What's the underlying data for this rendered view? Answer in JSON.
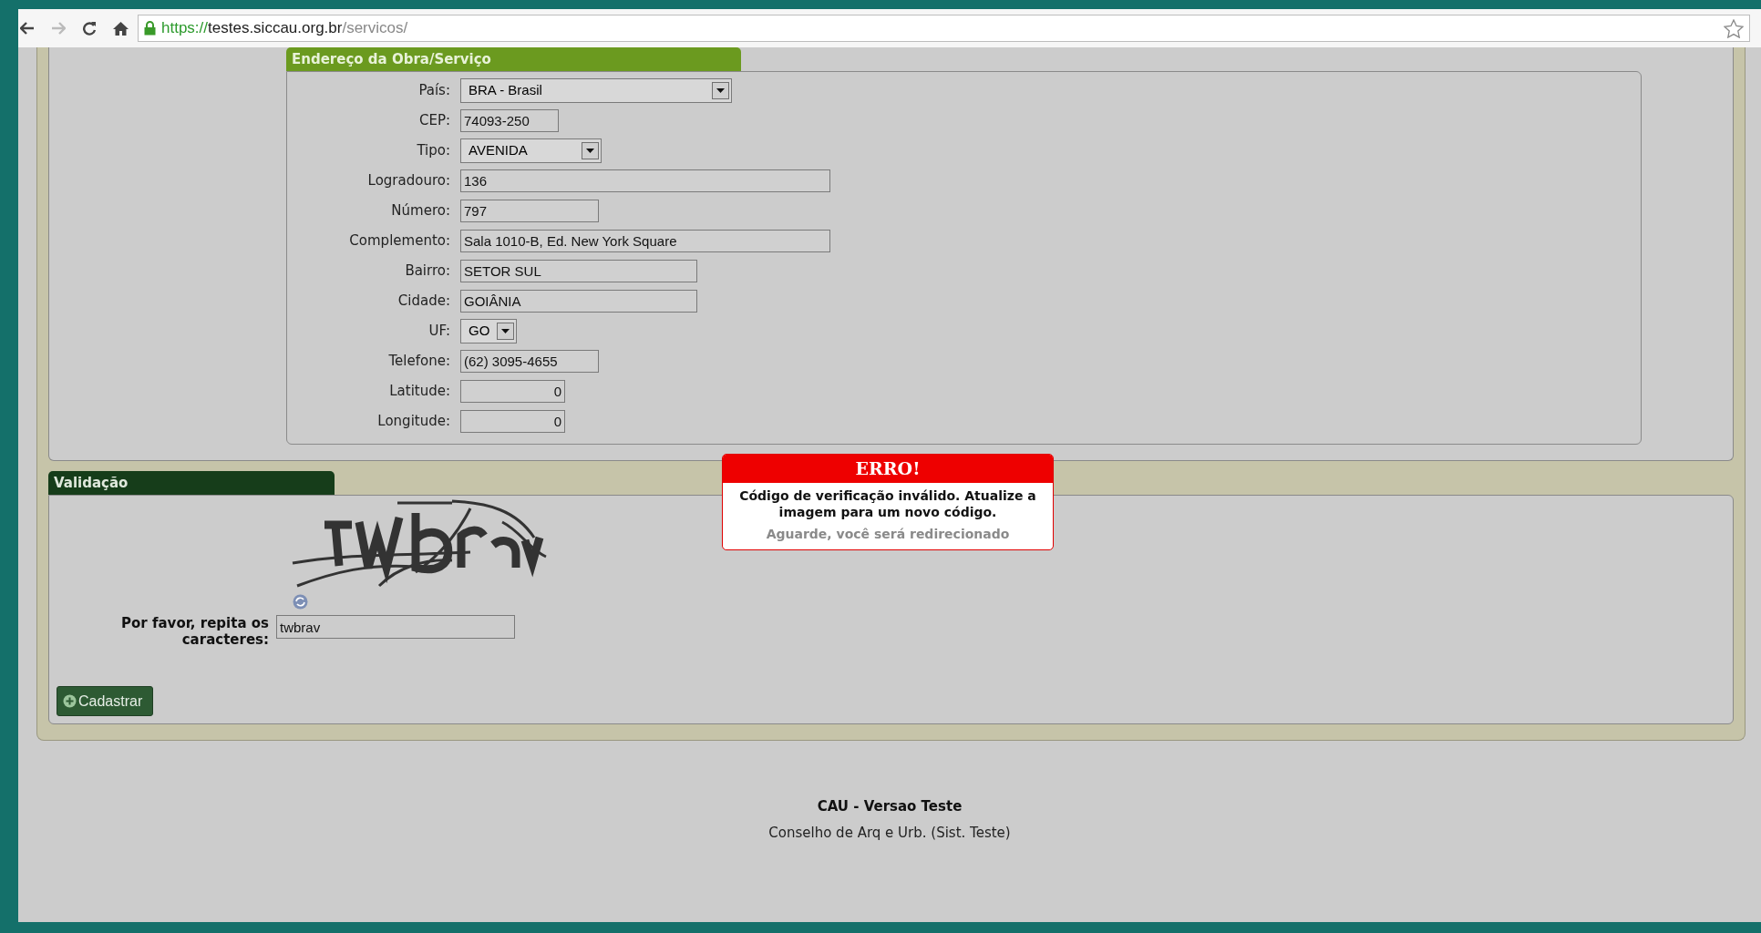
{
  "browser": {
    "url_scheme": "https://",
    "url_host": "testes.siccau.org.br",
    "url_path": "/servicos/"
  },
  "address_section": {
    "title": "Endereço da Obra/Serviço",
    "fields": [
      {
        "kind": "select",
        "label": "País:",
        "value": "BRA - Brasil"
      },
      {
        "kind": "text",
        "label": "CEP:",
        "value": "74093-250"
      },
      {
        "kind": "select",
        "label": "Tipo:",
        "value": "AVENIDA"
      },
      {
        "kind": "text",
        "label": "Logradouro:",
        "value": "136"
      },
      {
        "kind": "text",
        "label": "Número:",
        "value": "797"
      },
      {
        "kind": "text",
        "label": "Complemento:",
        "value": "Sala 1010-B, Ed. New York Square"
      },
      {
        "kind": "text",
        "label": "Bairro:",
        "value": "SETOR SUL"
      },
      {
        "kind": "text",
        "label": "Cidade:",
        "value": "GOIÂNIA"
      },
      {
        "kind": "select",
        "label": "UF:",
        "value": "GO"
      },
      {
        "kind": "text",
        "label": "Telefone:",
        "value": "(62) 3095-4655"
      },
      {
        "kind": "number",
        "label": "Latitude:",
        "value": "0"
      },
      {
        "kind": "number",
        "label": "Longitude:",
        "value": "0"
      }
    ]
  },
  "validation_section": {
    "title": "Validação",
    "captcha_label": "Por favor, repita os caracteres:",
    "captcha_value": "twbrav",
    "submit_button": "Cadastrar"
  },
  "error_dialog": {
    "title": "ERRO!",
    "message": "Código de verificação inválido. Atualize a imagem para um novo código.",
    "note": "Aguarde, você será redirecionado"
  },
  "footer": {
    "title": "CAU - Versao Teste",
    "subtitle": "Conselho de Arq e Urb. (Sist. Teste)"
  }
}
